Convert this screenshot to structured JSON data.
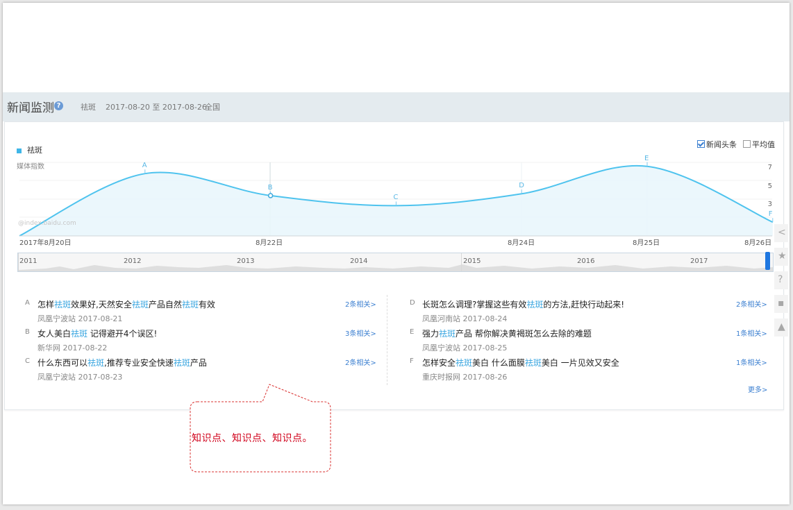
{
  "header": {
    "title": "新闻监测",
    "keyword": "祛斑",
    "date_range": "2017-08-20 至 2017-08-26",
    "region": "全国"
  },
  "help_icon": "?",
  "legend": {
    "series_name": "祛斑",
    "color": "#3fb6e8"
  },
  "toggles": {
    "headline_label": "新闻头条",
    "headline_checked": true,
    "average_label": "平均值",
    "average_checked": false
  },
  "watermark": "@index.baidu.com",
  "chart_data": {
    "type": "area",
    "ylabel": "媒体指数",
    "y_ticks": [
      "7",
      "5",
      "3"
    ],
    "x_tick_labels": [
      "2017年8月20日",
      "8月22日",
      "8月24日",
      "8月25日",
      "8月26日"
    ],
    "series": [
      {
        "name": "祛斑",
        "color": "#4ec3ee",
        "points": [
          {
            "label": "A",
            "date": "2017-08-21",
            "value": 6.8
          },
          {
            "label": "B",
            "date": "2017-08-22",
            "value": 4.4
          },
          {
            "label": "C",
            "date": "2017-08-23",
            "value": 3.3
          },
          {
            "label": "D",
            "date": "2017-08-24",
            "value": 4.6
          },
          {
            "label": "E",
            "date": "2017-08-25",
            "value": 7.6
          },
          {
            "label": "F",
            "date": "2017-08-26",
            "value": 1.5
          }
        ]
      }
    ]
  },
  "timeline": {
    "years": [
      "2011",
      "2012",
      "2013",
      "2014",
      "2015",
      "2016",
      "2017"
    ]
  },
  "news": {
    "left": [
      {
        "letter": "A",
        "title": [
          "怎样",
          "祛斑",
          "效果好,天然安全",
          "祛斑",
          "产品自然",
          "祛斑",
          "有效"
        ],
        "source": "凤凰宁波站 2017-08-21",
        "related": "2条相关>"
      },
      {
        "letter": "B",
        "title": [
          "女人美白",
          "祛斑",
          " 记得避开4个误区!"
        ],
        "source": "新华网 2017-08-22",
        "related": "3条相关>"
      },
      {
        "letter": "C",
        "title": [
          "什么东西可以",
          "祛斑",
          ",推荐专业安全快速",
          "祛斑",
          "产品"
        ],
        "source": "凤凰宁波站 2017-08-23",
        "related": "2条相关>"
      }
    ],
    "right": [
      {
        "letter": "D",
        "title": [
          "长斑怎么调理?掌握这些有效",
          "祛斑",
          "的方法,赶快行动起来!"
        ],
        "source": "凤凰河南站 2017-08-24",
        "related": "2条相关>"
      },
      {
        "letter": "E",
        "title": [
          "强力",
          "祛斑",
          "产品 帮你解决黄褐斑怎么去除的难题"
        ],
        "source": "凤凰宁波站 2017-08-25",
        "related": "1条相关>"
      },
      {
        "letter": "F",
        "title": [
          "怎样安全",
          "祛斑",
          "美白 什么面膜",
          "祛斑",
          "美白 一片见效又安全"
        ],
        "source": "重庆时报网 2017-08-26",
        "related": "1条相关>"
      }
    ],
    "more": "更多>"
  },
  "callout": {
    "text": "知识点、知识点、知识点。"
  },
  "side_tools": [
    "share-icon",
    "star-icon",
    "help-circle-icon",
    "chat-icon",
    "back-to-top-icon"
  ]
}
